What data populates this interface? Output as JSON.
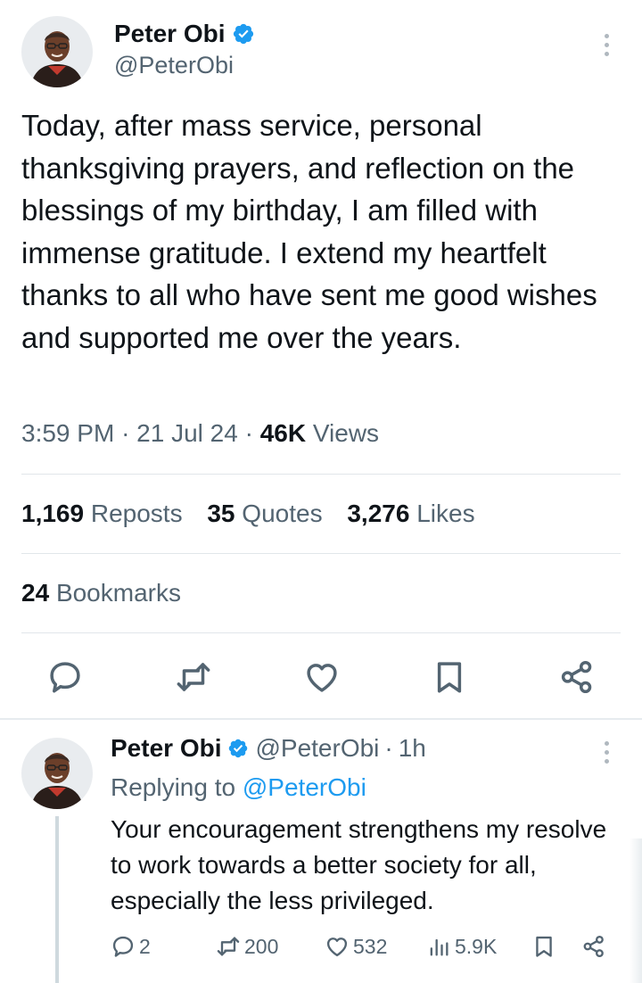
{
  "main_tweet": {
    "display_name": "Peter Obi",
    "handle": "@PeterObi",
    "text": "Today, after mass service, personal thanksgiving prayers, and reflection on the blessings of my birthday, I am filled with immense gratitude. I extend my heartfelt thanks to all who have sent me good wishes and supported me over the years.",
    "time": "3:59 PM",
    "date": "21 Jul 24",
    "meta_separator": "·",
    "views_count": "46K",
    "views_label": "Views",
    "reposts_count": "1,169",
    "reposts_label": "Reposts",
    "quotes_count": "35",
    "quotes_label": "Quotes",
    "likes_count": "3,276",
    "likes_label": "Likes",
    "bookmarks_count": "24",
    "bookmarks_label": "Bookmarks",
    "actions": [
      "reply-icon",
      "retweet-icon",
      "heart-icon",
      "bookmark-icon",
      "share-icon"
    ]
  },
  "reply_tweet": {
    "display_name": "Peter Obi",
    "handle": "@PeterObi",
    "separator": "·",
    "time": "1h",
    "replying_prefix": "Replying to",
    "replying_to": "@PeterObi",
    "text": "Your encouragement strengthens my resolve to work towards a better society for all, especially the less privileged.",
    "replies": "2",
    "reposts": "200",
    "likes": "532",
    "views": "5.9K",
    "actions": [
      "reply-icon",
      "retweet-icon",
      "heart-icon",
      "views-icon",
      "bookmark-icon",
      "share-icon"
    ]
  },
  "colors": {
    "text": "#0f1419",
    "secondary": "#536471",
    "accent": "#1d9bf0",
    "divider": "#e1e6ea"
  }
}
